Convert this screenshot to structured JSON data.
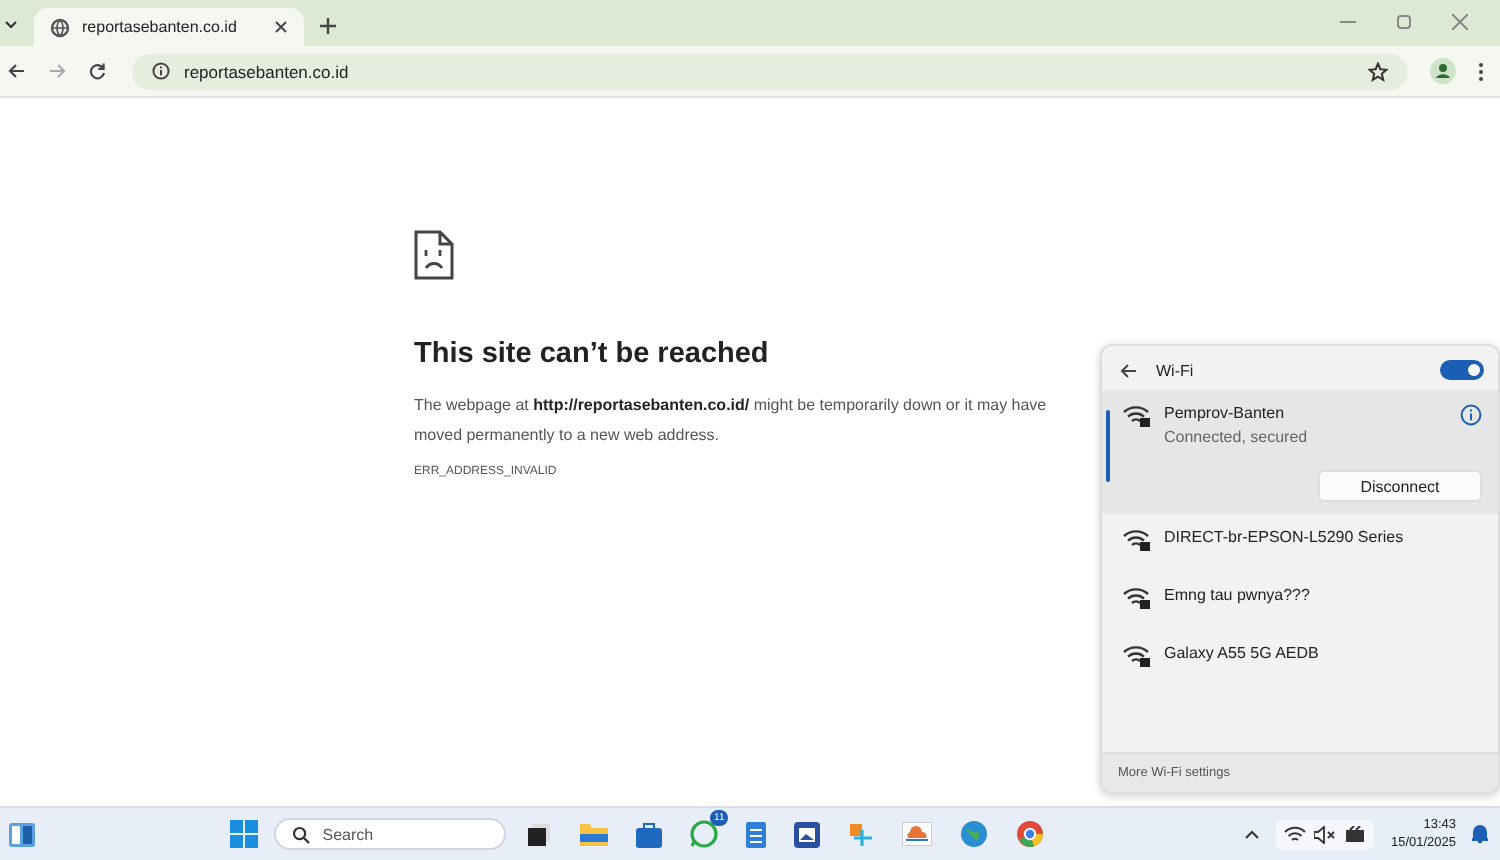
{
  "browser": {
    "tab": {
      "title": "reportasebanten.co.id"
    },
    "address": "reportasebanten.co.id"
  },
  "error_page": {
    "title": "This site can’t be reached",
    "message": "The webpage at **http://reportasebanten.co.id/** might be temporarily down or it may have moved permanently to a new web address.",
    "code": "ERR_ADDRESS_INVALID"
  },
  "wifi_panel": {
    "title": "Wi-Fi",
    "on": true,
    "networks": [
      {
        "name": "Pemprov-Banten",
        "status": "Connected, secured",
        "action": "Disconnect",
        "selected": true
      },
      {
        "name": "DIRECT-br-EPSON-L5290 Series",
        "selected": false
      },
      {
        "name": "Emng tau pwnya???",
        "selected": false
      },
      {
        "name": "Galaxy A55 5G AEDB",
        "selected": false
      }
    ],
    "footer": "More Wi-Fi settings"
  },
  "taskbar": {
    "search_placeholder": "Search",
    "badge": "11",
    "time": "13:43",
    "date": "15/01/2025"
  }
}
